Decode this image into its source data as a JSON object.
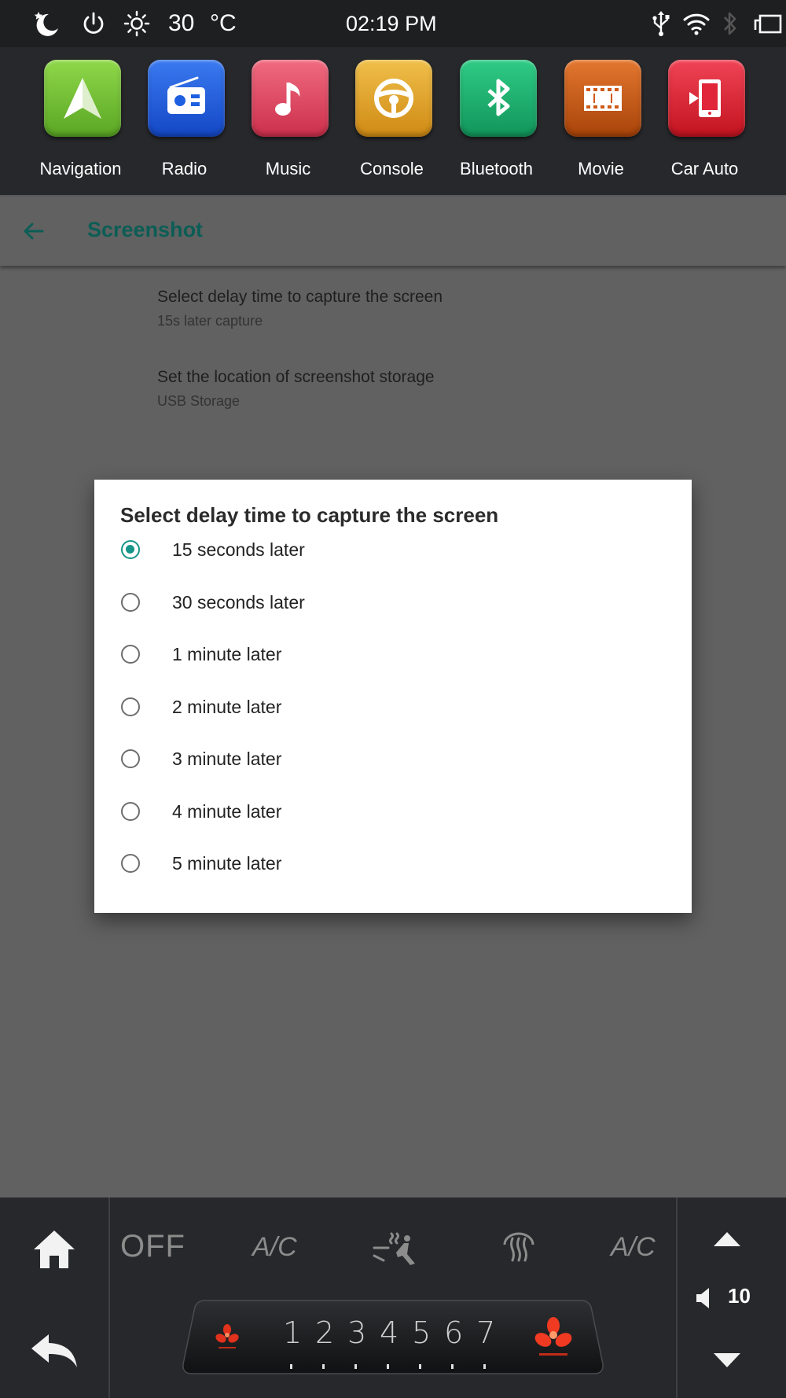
{
  "status_bar": {
    "temperature_value": "30",
    "temperature_unit": "°C",
    "time": "02:19 PM"
  },
  "apps": [
    {
      "label": "Navigation",
      "icon": "navigation-arrow-icon",
      "color": "#7cc63a"
    },
    {
      "label": "Radio",
      "icon": "radio-icon",
      "color": "#1d5fe0"
    },
    {
      "label": "Music",
      "icon": "music-note-icon",
      "color": "#e04a63"
    },
    {
      "label": "Console",
      "icon": "steering-wheel-icon",
      "color": "#e3a629"
    },
    {
      "label": "Bluetooth",
      "icon": "bluetooth-icon",
      "color": "#1fae6e"
    },
    {
      "label": "Movie",
      "icon": "film-icon",
      "color": "#cf5a17"
    },
    {
      "label": "Car Auto",
      "icon": "phone-link-icon",
      "color": "#e1263a"
    }
  ],
  "page": {
    "title": "Screenshot",
    "prefs": [
      {
        "title": "Select delay time to capture the screen",
        "summary": "15s later capture"
      },
      {
        "title": "Set the location of screenshot storage",
        "summary": "USB Storage"
      }
    ]
  },
  "dialog": {
    "title": "Select delay time to capture the screen",
    "accent": "#149588",
    "selected_index": 0,
    "options": [
      "15 seconds later",
      "30 seconds later",
      "1 minute later",
      "2 minute later",
      "3 minute later",
      "4 minute later",
      "5 minute later"
    ]
  },
  "climate": {
    "off_label": "OFF",
    "ac_left": "A/C",
    "ac_right": "A/C",
    "fan_speeds": [
      "1",
      "2",
      "3",
      "4",
      "5",
      "6",
      "7"
    ],
    "volume": "10"
  }
}
